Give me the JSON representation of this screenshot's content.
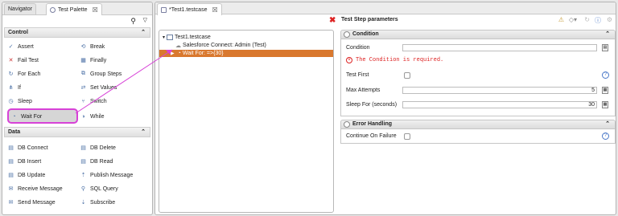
{
  "left_panel": {
    "tabs": [
      {
        "label": "Navigator"
      },
      {
        "label": "Test Palette"
      }
    ],
    "sections": {
      "control": {
        "title": "Control",
        "items": [
          "Assert",
          "Break",
          "Fail Test",
          "Finally",
          "For Each",
          "Group Steps",
          "If",
          "Set Values",
          "Sleep",
          "Switch",
          "Wait For",
          "While"
        ]
      },
      "data": {
        "title": "Data",
        "items": [
          "DB Connect",
          "DB Delete",
          "DB Insert",
          "DB Read",
          "DB Update",
          "Publish Message",
          "Receive Message",
          "SQL Query",
          "Send Message",
          "Subscribe"
        ]
      }
    }
  },
  "editor": {
    "tab_label": "*Test1.testcase",
    "params_title": "Test Step parameters",
    "tree": {
      "root": "Test1.testcase",
      "child1": "Salesforce Connect: Admin (Test)",
      "child2": "Wait For: =>{30}"
    },
    "condition_group": {
      "title": "Condition",
      "condition_label": "Condition",
      "condition_value": "",
      "error": "The Condition is required.",
      "test_first_label": "Test First",
      "max_attempts_label": "Max Attempts",
      "max_attempts_value": "5",
      "sleep_for_label": "Sleep For (seconds)",
      "sleep_for_value": "30"
    },
    "error_group": {
      "title": "Error Handling",
      "continue_label": "Continue On Failure"
    }
  },
  "colors": {
    "selection": "#d9782e",
    "highlight": "#d742d7",
    "error": "#dd2222"
  }
}
